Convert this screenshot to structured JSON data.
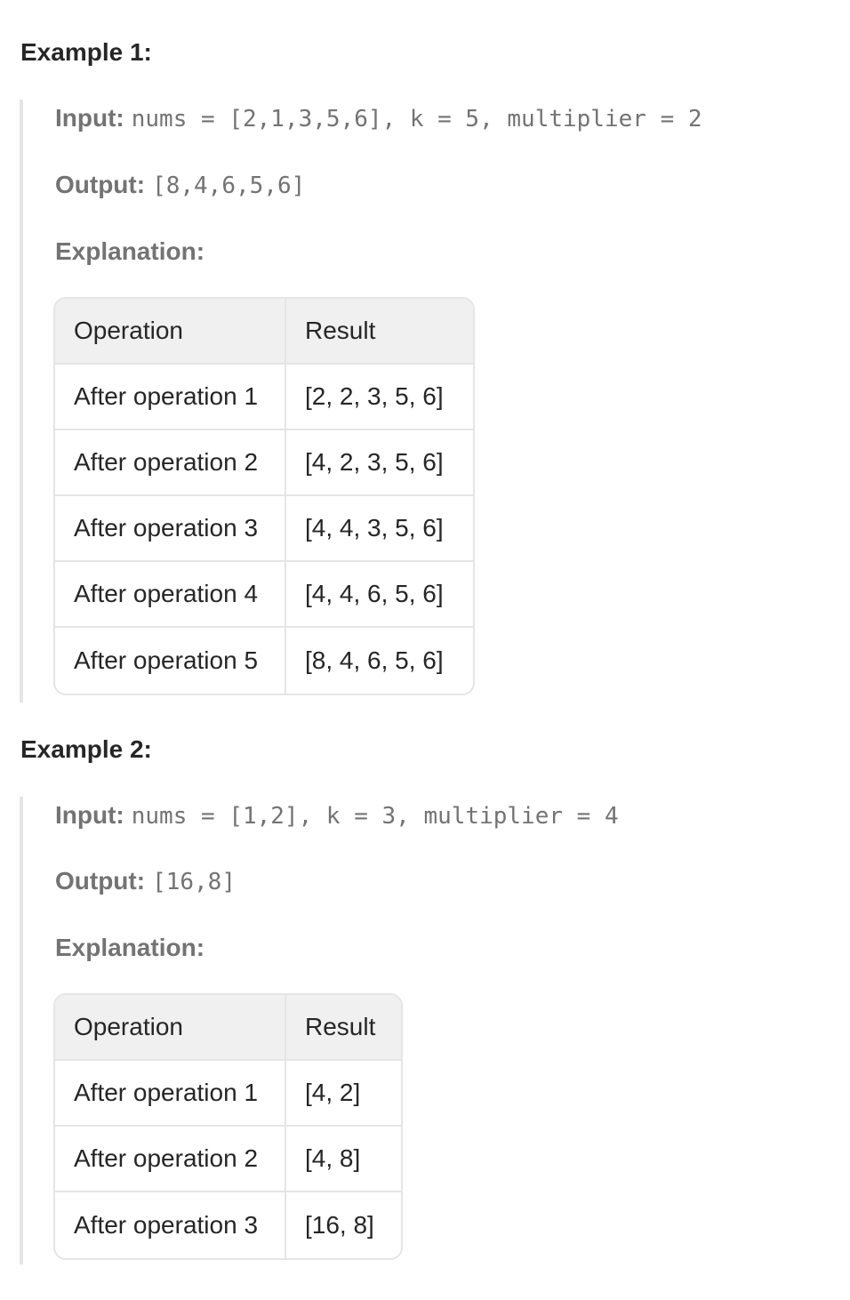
{
  "examples": [
    {
      "heading": "Example 1:",
      "input_label": "Input:",
      "input_value": "nums = [2,1,3,5,6], k = 5, multiplier = 2",
      "output_label": "Output:",
      "output_value": "[8,4,6,5,6]",
      "explanation_label": "Explanation:",
      "table": {
        "headers": [
          "Operation",
          "Result"
        ],
        "rows": [
          [
            "After operation 1",
            "[2, 2, 3, 5, 6]"
          ],
          [
            "After operation 2",
            "[4, 2, 3, 5, 6]"
          ],
          [
            "After operation 3",
            "[4, 4, 3, 5, 6]"
          ],
          [
            "After operation 4",
            "[4, 4, 6, 5, 6]"
          ],
          [
            "After operation 5",
            "[8, 4, 6, 5, 6]"
          ]
        ]
      }
    },
    {
      "heading": "Example 2:",
      "input_label": "Input:",
      "input_value": "nums = [1,2], k = 3, multiplier = 4",
      "output_label": "Output:",
      "output_value": "[16,8]",
      "explanation_label": "Explanation:",
      "table": {
        "headers": [
          "Operation",
          "Result"
        ],
        "rows": [
          [
            "After operation 1",
            "[4, 2]"
          ],
          [
            "After operation 2",
            "[4, 8]"
          ],
          [
            "After operation 3",
            "[16, 8]"
          ]
        ]
      }
    }
  ]
}
